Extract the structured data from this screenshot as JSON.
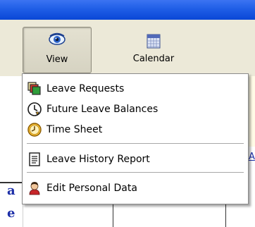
{
  "toolbar": {
    "view_label": "View",
    "calendar_label": "Calendar"
  },
  "menu": {
    "items": [
      {
        "label": "Leave Requests",
        "icon": "documents-icon"
      },
      {
        "label": "Future Leave Balances",
        "icon": "clock-arrow-icon"
      },
      {
        "label": "Time Sheet",
        "icon": "clock-icon"
      },
      {
        "label": "Leave History Report",
        "icon": "report-icon"
      },
      {
        "label": "Edit Personal Data",
        "icon": "person-icon"
      }
    ]
  },
  "background": {
    "fragment_a": "a",
    "fragment_e": "e",
    "fragment_link": "A"
  }
}
